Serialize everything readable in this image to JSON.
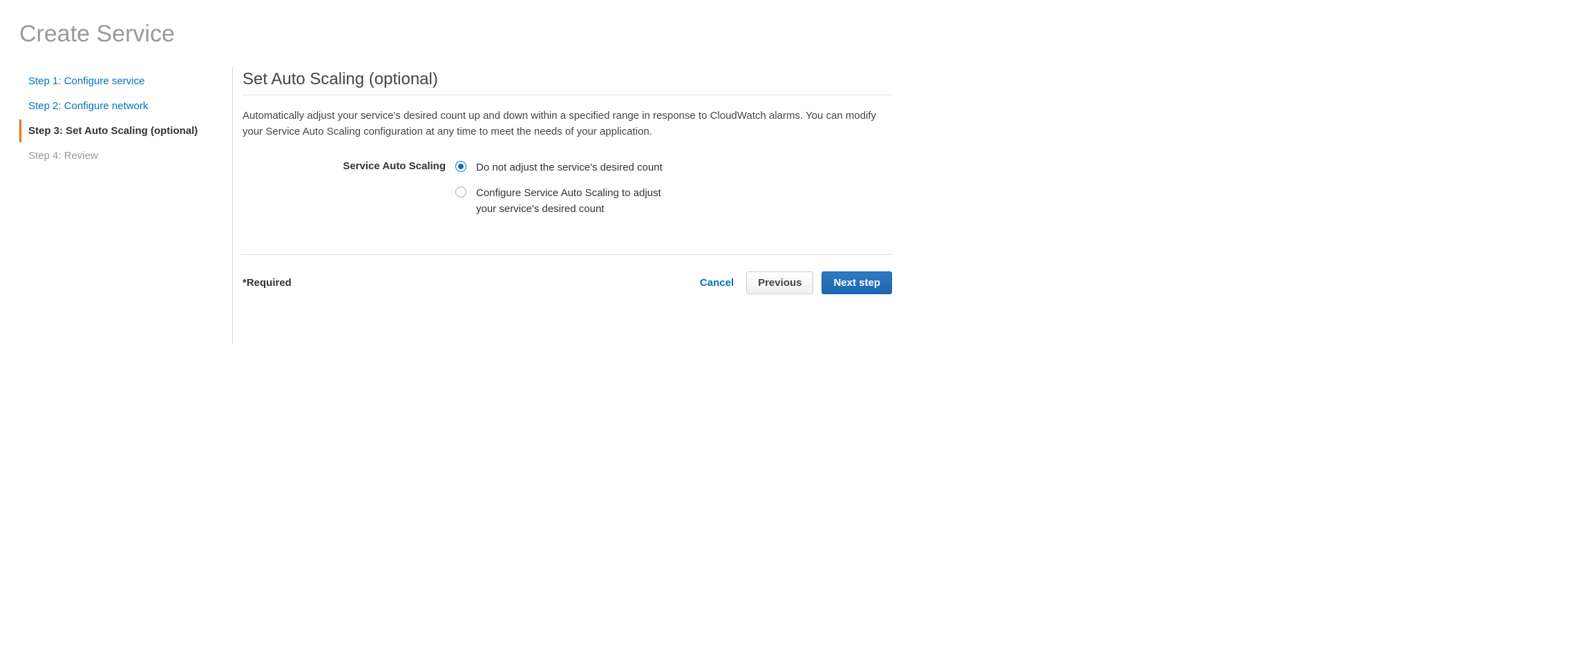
{
  "header": {
    "title": "Create Service"
  },
  "sidebar": {
    "steps": [
      {
        "label": "Step 1: Configure service",
        "state": "link"
      },
      {
        "label": "Step 2: Configure network",
        "state": "link"
      },
      {
        "label": "Step 3: Set Auto Scaling (optional)",
        "state": "active"
      },
      {
        "label": "Step 4: Review",
        "state": "disabled"
      }
    ]
  },
  "main": {
    "section_title": "Set Auto Scaling (optional)",
    "description": "Automatically adjust your service's desired count up and down within a specified range in response to CloudWatch alarms. You can modify your Service Auto Scaling configuration at any time to meet the needs of your application.",
    "form": {
      "auto_scaling_label": "Service Auto Scaling",
      "options": [
        {
          "label": "Do not adjust the service's desired count",
          "selected": true
        },
        {
          "label": "Configure Service Auto Scaling to adjust your service's desired count",
          "selected": false
        }
      ]
    }
  },
  "footer": {
    "required_label": "*Required",
    "cancel_label": "Cancel",
    "previous_label": "Previous",
    "next_label": "Next step"
  }
}
